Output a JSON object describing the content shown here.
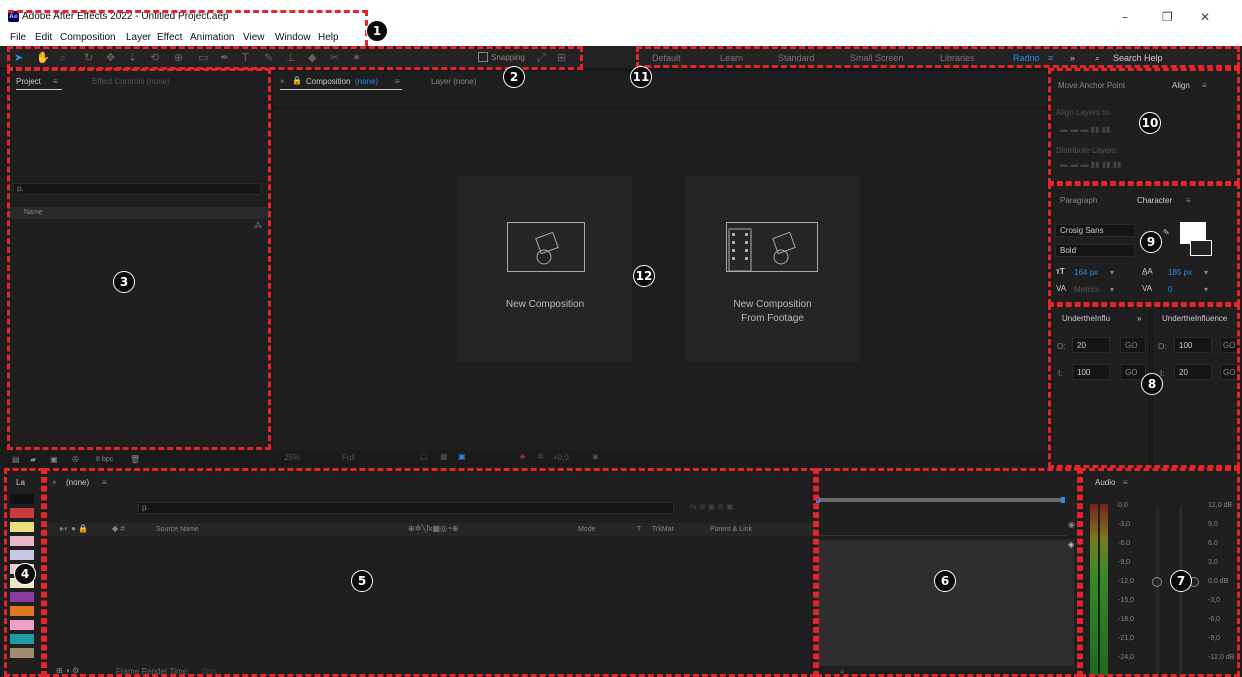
{
  "window": {
    "title": "Adobe After Effects 2022 - Untitled Project.aep",
    "app_icon_text": "Ae",
    "controls": {
      "minimize": "–",
      "restore": "❐",
      "close": "✕"
    }
  },
  "menu": [
    "File",
    "Edit",
    "Composition",
    "Layer",
    "Effect",
    "Animation",
    "View",
    "Window",
    "Help"
  ],
  "toolbar": {
    "snapping_label": "Snapping",
    "workspaces": [
      "Default",
      "Learn",
      "Standard",
      "Small Screen",
      "Libraries",
      "Radno"
    ],
    "active_workspace": "Radno",
    "overflow": "»",
    "search_help": "Search Help"
  },
  "project_panel": {
    "tabs": [
      "Project",
      "Effect Controls (none)"
    ],
    "search_placeholder": "ρ.",
    "name_header": "Name",
    "bpc_label": "8 bpc"
  },
  "composition_panel": {
    "close": "×",
    "tab_prefix": "Composition",
    "tab_value": "(none)",
    "layer_tab": "Layer  (none)",
    "new_composition": "New Composition",
    "new_from_footage_line1": "New Composition",
    "new_from_footage_line2": "From Footage",
    "zoom": "25%",
    "resolution": "Full",
    "exposure": "+0,0"
  },
  "align_panel": {
    "tabs": [
      "Move Anchor Point",
      "Align"
    ],
    "align_layers_to": "Align Layers to:",
    "distribute_layers": "Distribute Layers:"
  },
  "character_panel": {
    "tabs": [
      "Paragraph",
      "Character"
    ],
    "font": "Crosig Sans",
    "style": "Bold",
    "font_size": "164 px",
    "leading": "185 px",
    "kerning": "Metrics",
    "tracking": "0"
  },
  "script_panels": [
    {
      "title": "UndertheInflu",
      "o_value": "20",
      "i_value": "100",
      "go": "GO"
    },
    {
      "title": "UndertheInfluence",
      "o_value": "100",
      "i_value": "20",
      "go": "GO"
    }
  ],
  "labels_panel": {
    "title": "La",
    "colors": [
      "#111111",
      "#c83c3c",
      "#e8e07a",
      "#e6b8c8",
      "#c8c8e6",
      "#e6c8c8",
      "#f0e6c8",
      "#8a3ca0",
      "#e0781e",
      "#eea0c8",
      "#1e9ea0",
      "#a08c6e"
    ]
  },
  "timeline_panel": {
    "tab": "(none)",
    "search_placeholder": "ρ.",
    "source_name": "Source Name",
    "mode": "Mode",
    "t": "T",
    "trkmat": "TrkMat",
    "parent_link": "Parent & Link",
    "frame_render_time": "Frame Render Time:",
    "frame_render_value": "0ms"
  },
  "audio_panel": {
    "title": "Audio",
    "left_scale": [
      "0,0",
      "-3,0",
      "-6,0",
      "-9,0",
      "-12,0",
      "-15,0",
      "-18,0",
      "-21,0",
      "-24,0"
    ],
    "right_scale": [
      "12,0 dB",
      "9,0",
      "6,0",
      "3,0",
      "0,0 dB",
      "-3,0",
      "-6,0",
      "-9,0",
      "-12,0 dB"
    ]
  },
  "annotations": [
    "1",
    "2",
    "3",
    "4",
    "5",
    "6",
    "7",
    "8",
    "9",
    "10",
    "11",
    "12"
  ],
  "colors": {
    "annotation": "#e3262c",
    "accent": "#2d8ceb",
    "panel_bg": "#1f1f1f"
  }
}
